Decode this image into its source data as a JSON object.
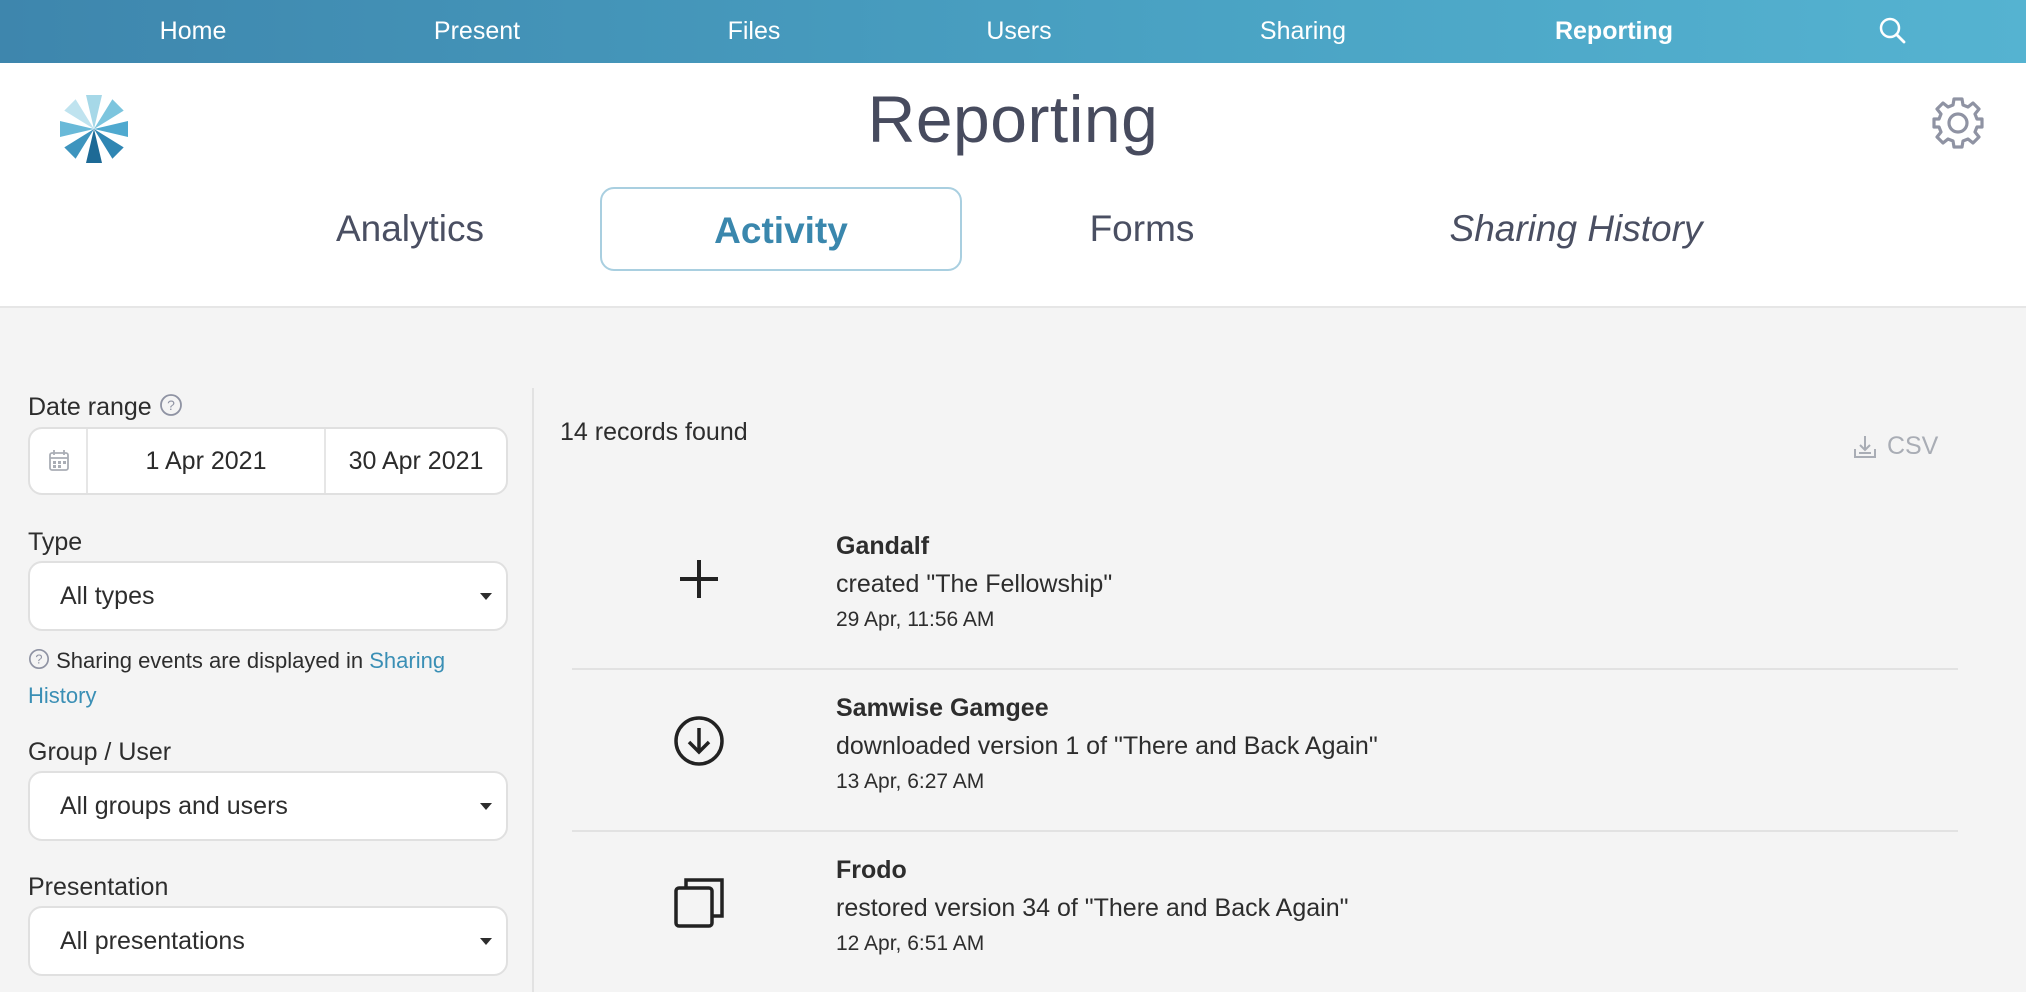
{
  "nav": {
    "items": [
      {
        "label": "Home"
      },
      {
        "label": "Present"
      },
      {
        "label": "Files"
      },
      {
        "label": "Users"
      },
      {
        "label": "Sharing"
      },
      {
        "label": "Reporting",
        "active": true
      }
    ]
  },
  "header": {
    "title": "Reporting",
    "tabs": [
      {
        "label": "Analytics"
      },
      {
        "label": "Activity",
        "active": true
      },
      {
        "label": "Forms"
      },
      {
        "label": "Sharing History"
      }
    ]
  },
  "filters": {
    "date_range_label": "Date range",
    "date_from": "1 Apr 2021",
    "date_to": "30 Apr 2021",
    "type_label": "Type",
    "type_value": "All types",
    "note_text": "Sharing events are displayed in ",
    "note_link": "Sharing History",
    "group_label": "Group / User",
    "group_value": "All groups and users",
    "presentation_label": "Presentation",
    "presentation_value": "All presentations"
  },
  "results": {
    "count_text": "14 records found",
    "csv_label": "CSV",
    "entries": [
      {
        "icon": "plus-icon",
        "name": "Gandalf",
        "description": "created \"The Fellowship\"",
        "time": "29 Apr, 11:56 AM"
      },
      {
        "icon": "download-circle-icon",
        "name": "Samwise Gamgee",
        "description": "downloaded version 1 of \"There and Back Again\"",
        "time": "13 Apr, 6:27 AM"
      },
      {
        "icon": "copy-icon",
        "name": "Frodo",
        "description": "restored version 34 of \"There and Back Again\"",
        "time": "12 Apr, 6:51 AM"
      }
    ]
  },
  "colors": {
    "nav_start": "#3e86ad",
    "nav_end": "#55b3d1",
    "accent": "#3a87ad",
    "link": "#3a8fb5"
  }
}
